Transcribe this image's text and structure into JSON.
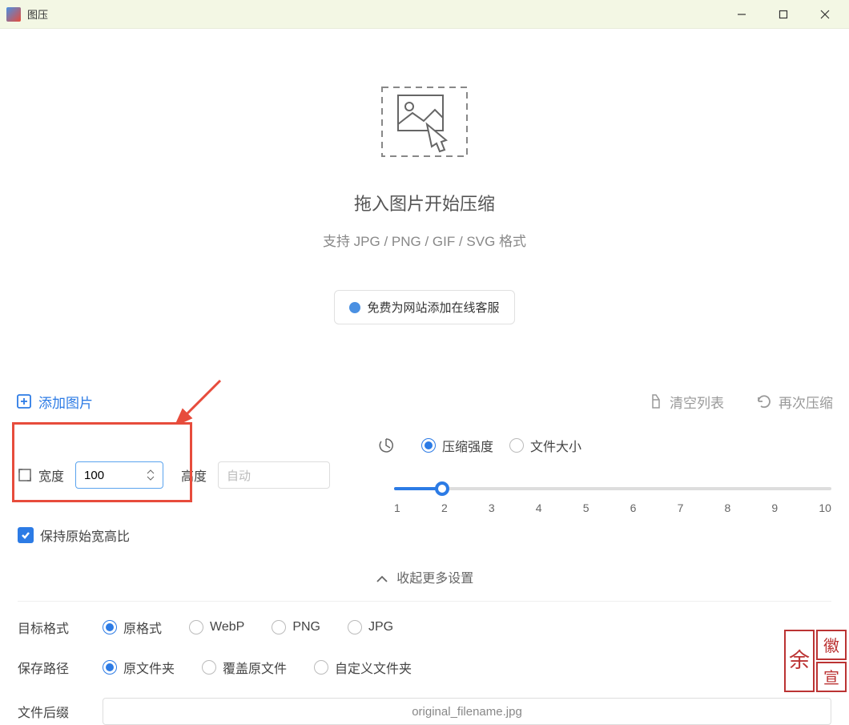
{
  "titlebar": {
    "title": "图压"
  },
  "dropzone": {
    "title": "拖入图片开始压缩",
    "subtitle": "支持 JPG / PNG / GIF / SVG 格式",
    "promo": "免费为网站添加在线客服"
  },
  "toolbar": {
    "add": "添加图片",
    "clear": "清空列表",
    "recompress": "再次压缩"
  },
  "settings": {
    "width_label": "宽度",
    "width_value": "100",
    "height_label": "高度",
    "height_placeholder": "自动",
    "keep_ratio": "保持原始宽高比",
    "compress_label": "压缩强度",
    "filesize_label": "文件大小",
    "slider_ticks": [
      "1",
      "2",
      "3",
      "4",
      "5",
      "6",
      "7",
      "8",
      "9",
      "10"
    ],
    "collapse": "收起更多设置",
    "target_format_label": "目标格式",
    "formats": [
      "原格式",
      "WebP",
      "PNG",
      "JPG"
    ],
    "save_path_label": "保存路径",
    "save_paths": [
      "原文件夹",
      "覆盖原文件",
      "自定义文件夹"
    ],
    "suffix_label": "文件后缀",
    "suffix_placeholder": "original_filename.jpg"
  }
}
